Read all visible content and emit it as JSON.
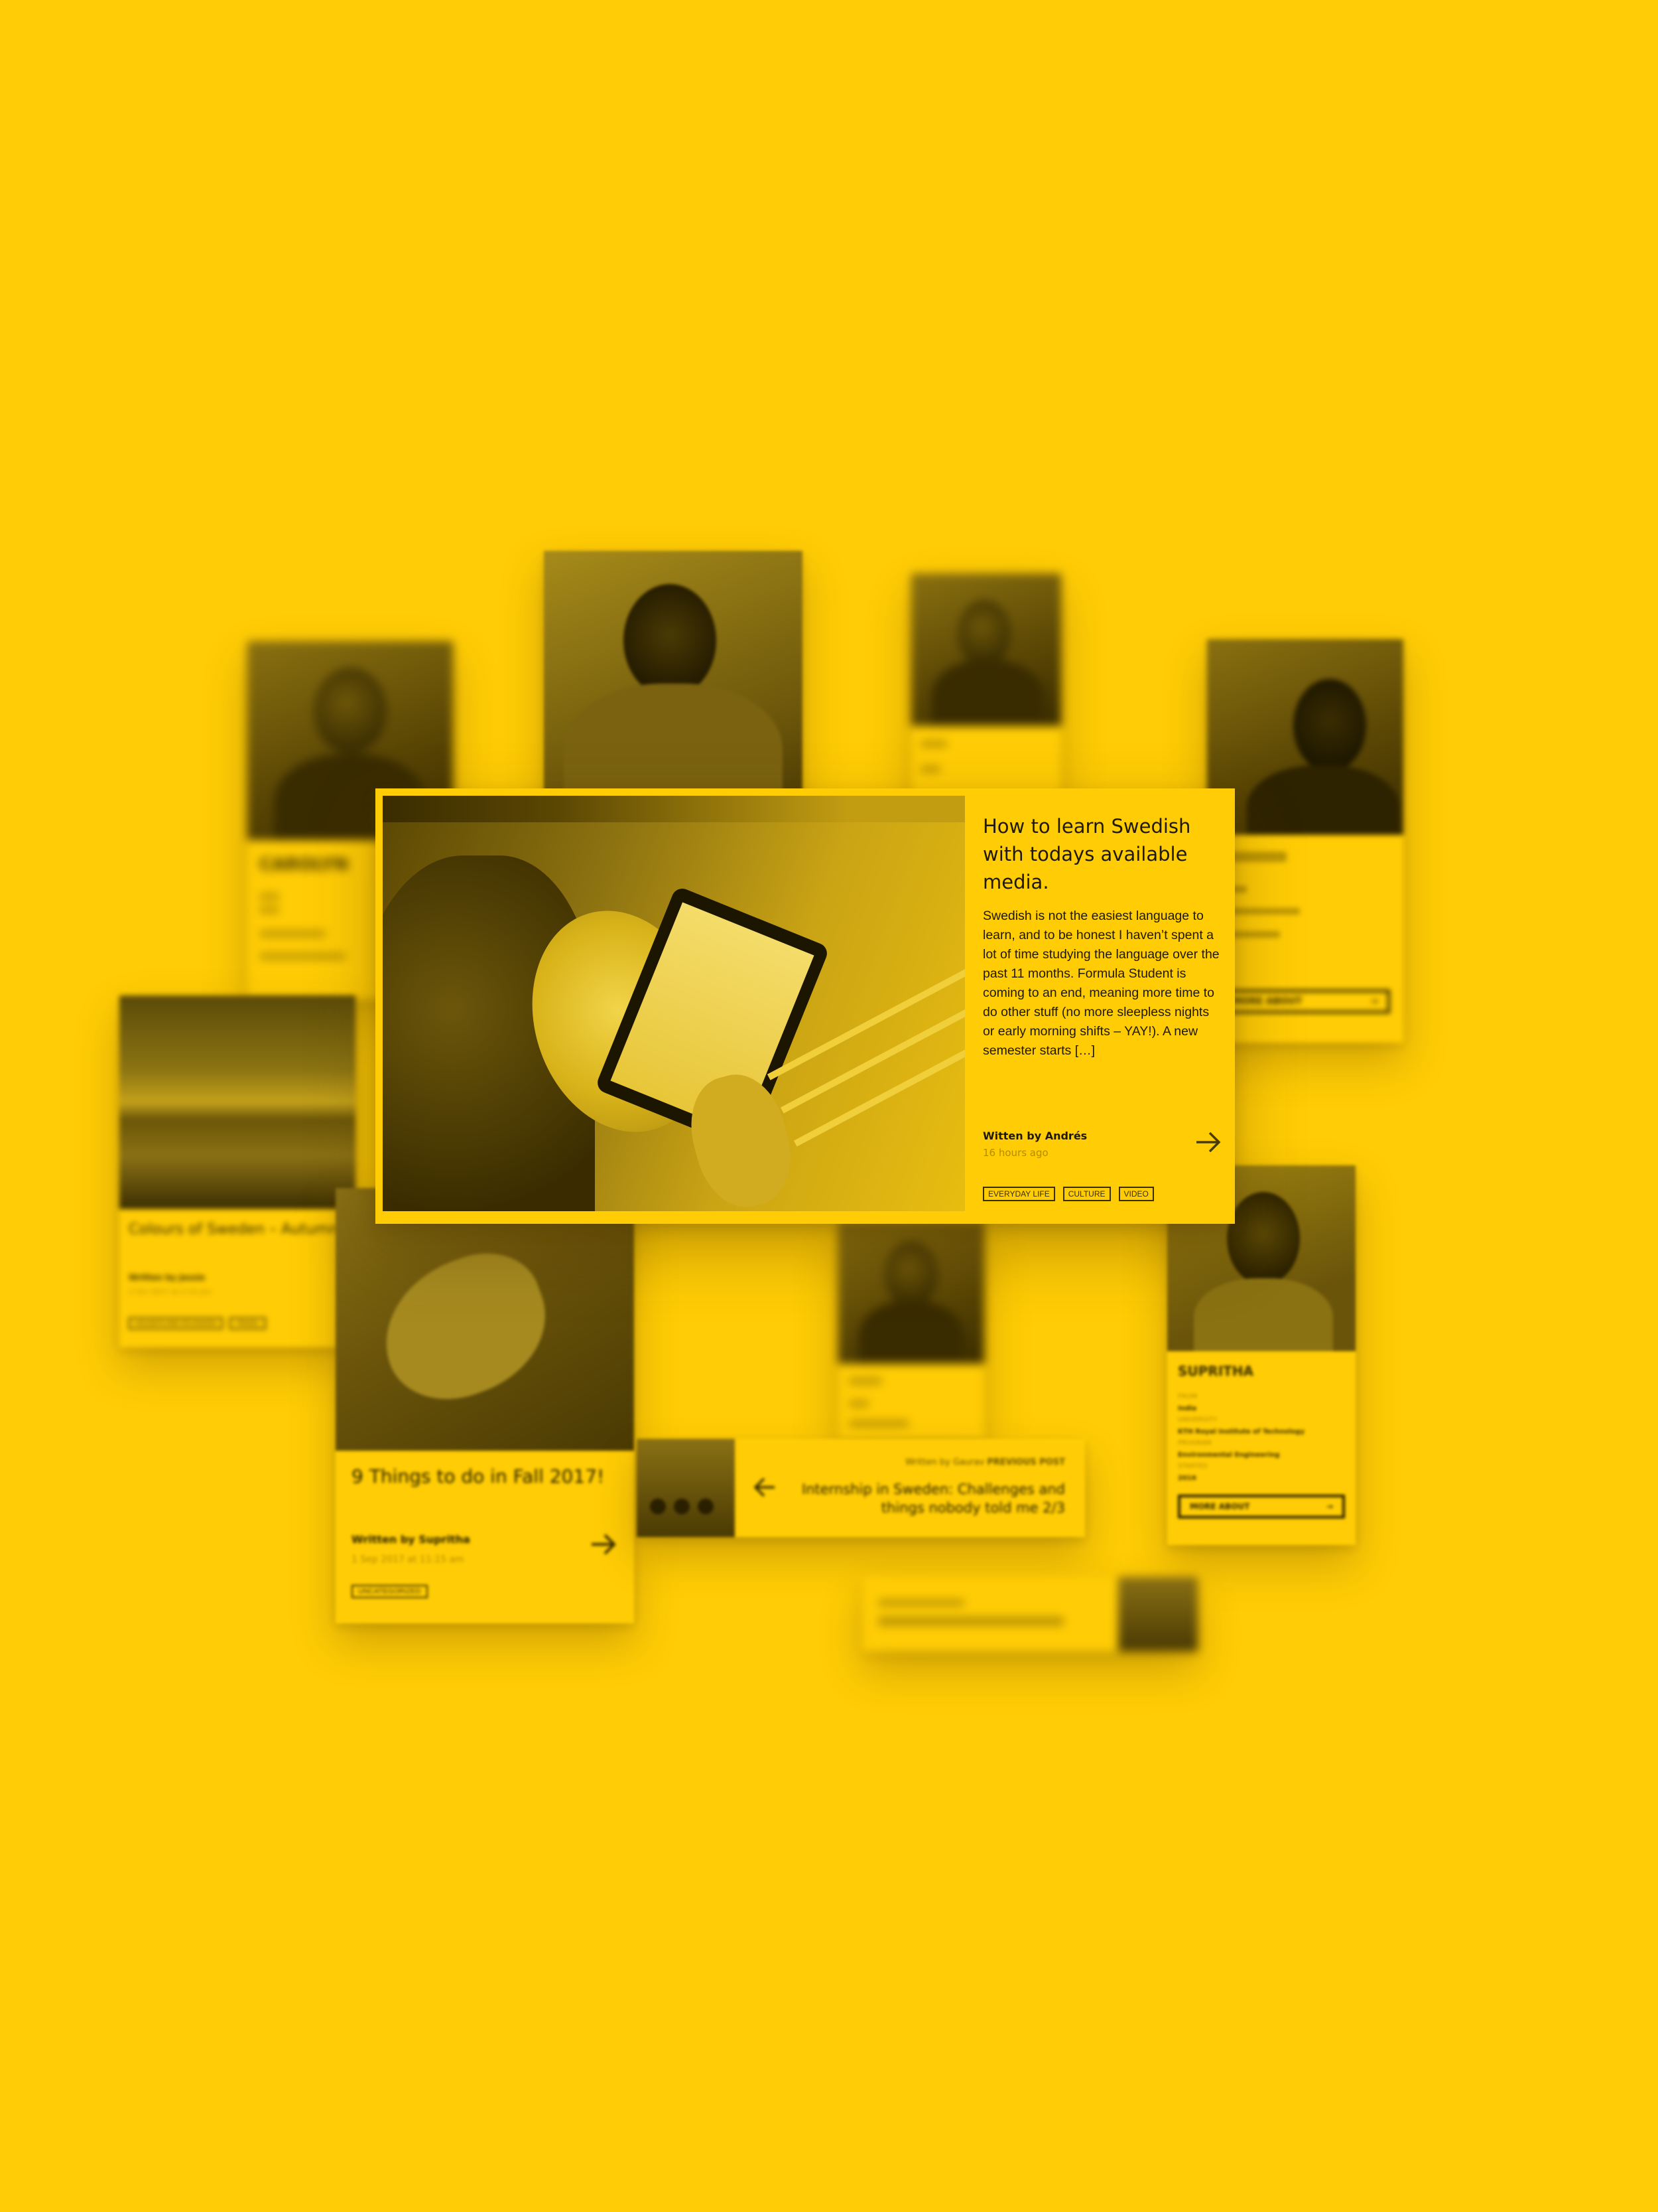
{
  "colors": {
    "background": "#FFCC05",
    "ink": "#1f1900",
    "muted": "#b28c00"
  },
  "feature": {
    "title": "How to learn Swedish with todays available media.",
    "excerpt": "Swedish is not the easiest language to learn, and to be honest I haven’t spent a lot of time studying the language over the past 11 months. Formula Student is coming to an end, meaning more time to do other stuff (no more sleepless nights or early morning shifts – YAY!). A new semester starts […]",
    "author": "Witten by Andrés",
    "time": "16 hours ago",
    "tags": [
      "EVERYDAY LIFE",
      "CULTURE",
      "VIDEO"
    ],
    "arrow_icon": "arrow-right-icon"
  },
  "post_autumn": {
    "title": "Colours of Sweden – Autumn",
    "author": "Written by Jessie",
    "time": "2 Oct 2017 at 2:15 pm",
    "tags": [
      "HOLIDAYS AND OCCASIONS",
      "TRAVEL"
    ]
  },
  "post_fall": {
    "title": "9 Things to do in Fall 2017!",
    "author": "Written by Supritha",
    "time": "1 Sep 2017 at 11:15 am",
    "tags": [
      "UNCATEGORIZED"
    ]
  },
  "internship": {
    "meta_label": "Written by Gaurav",
    "meta_tag": "PREVIOUS POST",
    "title": "Internship in Sweden: Challenges and things nobody told me 2/3"
  },
  "profiles": {
    "left_name": "CAROLYN",
    "right_top_more": "MORE ABOUT",
    "supritha": {
      "name": "SUPRITHA",
      "lines": [
        "FROM",
        "India",
        "UNIVERSITY",
        "KTH Royal Institute of Technology",
        "PROGRAM",
        "Environmental Engineering",
        "STARTED",
        "2016"
      ],
      "more_label": "MORE ABOUT"
    }
  }
}
